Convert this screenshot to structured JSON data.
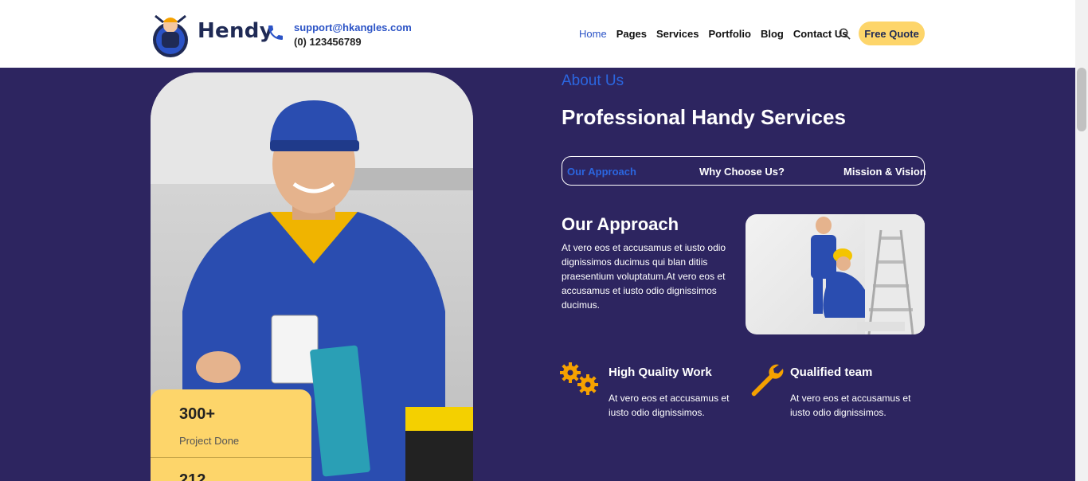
{
  "header": {
    "brand": "Hendy",
    "email": "support@hkangles.com",
    "phone": "(0) 123456789",
    "nav": [
      "Home",
      "Pages",
      "Services",
      "Portfolio",
      "Blog",
      "Contact Us"
    ],
    "active_nav": "Home",
    "quote_label": "Free Quote"
  },
  "stats": [
    {
      "value": "300+",
      "label": "Project Done"
    },
    {
      "value": "212",
      "label": ""
    }
  ],
  "about": {
    "eyebrow": "About Us",
    "title": "Professional Handy Services",
    "tabs": [
      "Our Approach",
      "Why Choose Us?",
      "Mission & Vision"
    ],
    "active_tab": "Our Approach",
    "approach_title": "Our Approach",
    "approach_text": "At vero eos et accusamus et iusto odio dignissimos ducimus qui blan ditiis praesentium voluptatum.At vero eos et accusamus et iusto odio dignissimos ducimus."
  },
  "features": [
    {
      "icon": "gears-icon",
      "title": "High Quality Work",
      "text": "At vero eos et accusamus et iusto odio dignissimos."
    },
    {
      "icon": "wrench-icon",
      "title": "Qualified team",
      "text": "At vero eos et accusamus et iusto odio dignissimos."
    }
  ],
  "colors": {
    "accent": "#2b66e0",
    "section_bg": "#2d2560",
    "highlight": "#fdd56a",
    "icon_orange": "#f5a100"
  }
}
